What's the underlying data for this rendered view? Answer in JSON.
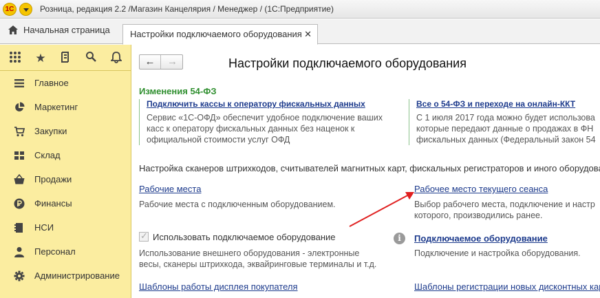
{
  "window": {
    "title": "Розница, редакция 2.2 /Магазин Канцелярия / Менеджер /  (1С:Предприятие)",
    "logo_text": "1С"
  },
  "tabs": {
    "home_label": "Начальная страница",
    "active_label": "Настройки подключаемого оборудования",
    "close_glyph": "✕"
  },
  "sidebar": {
    "toolbar_icons": [
      "apps-grid-icon",
      "star-icon",
      "history-icon",
      "search-icon",
      "bell-icon"
    ],
    "items": [
      {
        "label": "Главное",
        "icon": "list-icon"
      },
      {
        "label": "Маркетинг",
        "icon": "pie-chart-icon"
      },
      {
        "label": "Закупки",
        "icon": "cart-icon"
      },
      {
        "label": "Склад",
        "icon": "warehouse-icon"
      },
      {
        "label": "Продажи",
        "icon": "basket-icon"
      },
      {
        "label": "Финансы",
        "icon": "ruble-icon"
      },
      {
        "label": "НСИ",
        "icon": "reference-icon"
      },
      {
        "label": "Персонал",
        "icon": "person-icon"
      },
      {
        "label": "Администрирование",
        "icon": "gear-icon"
      }
    ]
  },
  "main": {
    "title": "Настройки подключаемого оборудования",
    "section_title": "Изменения 54-ФЗ",
    "news_left": {
      "link": "Подключить кассы к оператору фискальных данных",
      "text": [
        "Сервис  «1С-ОФД» обеспечит удобное подключение ваших",
        "касс к оператору фискальных данных без наценок к",
        "официальной стоимости услуг ОФД"
      ]
    },
    "news_right": {
      "link": "Все о 54-ФЗ и переходе на онлайн-ККТ",
      "text": [
        "С 1 июля 2017 года можно будет использова",
        "которые передают данные о продажах в ФН",
        "фискальных данных (Федеральный закон 54"
      ]
    },
    "description": "Настройка сканеров штрихкодов, считывателей магнитных карт, фискальных регистраторов и иного оборудова",
    "workplaces": {
      "link": "Рабочие места",
      "text": "Рабочие места с подключенным оборудованием."
    },
    "current_session": {
      "link": "Рабочее место текущего сеанса",
      "text": [
        "Выбор рабочего места, подключение и настр",
        "которого, производились ранее."
      ]
    },
    "use_equipment": {
      "label": "Использовать подключаемое оборудование",
      "checked": true,
      "text": [
        "Использование внешнего оборудования - электронные",
        "весы, сканеры штрихкода, эквайринговые терминалы и т.д."
      ]
    },
    "equipment": {
      "link": "Подключаемое оборудование",
      "text": "Подключение и настройка оборудования."
    },
    "display_templates": "Шаблоны работы дисплея покупателя",
    "discount_templates": "Шаблоны регистрации новых дисконтных кар"
  },
  "colors": {
    "sidebar_bg": "#fbeda0",
    "link": "#1c3a8c",
    "section_green": "#2f8f2f",
    "annotation_arrow": "#e02020"
  }
}
